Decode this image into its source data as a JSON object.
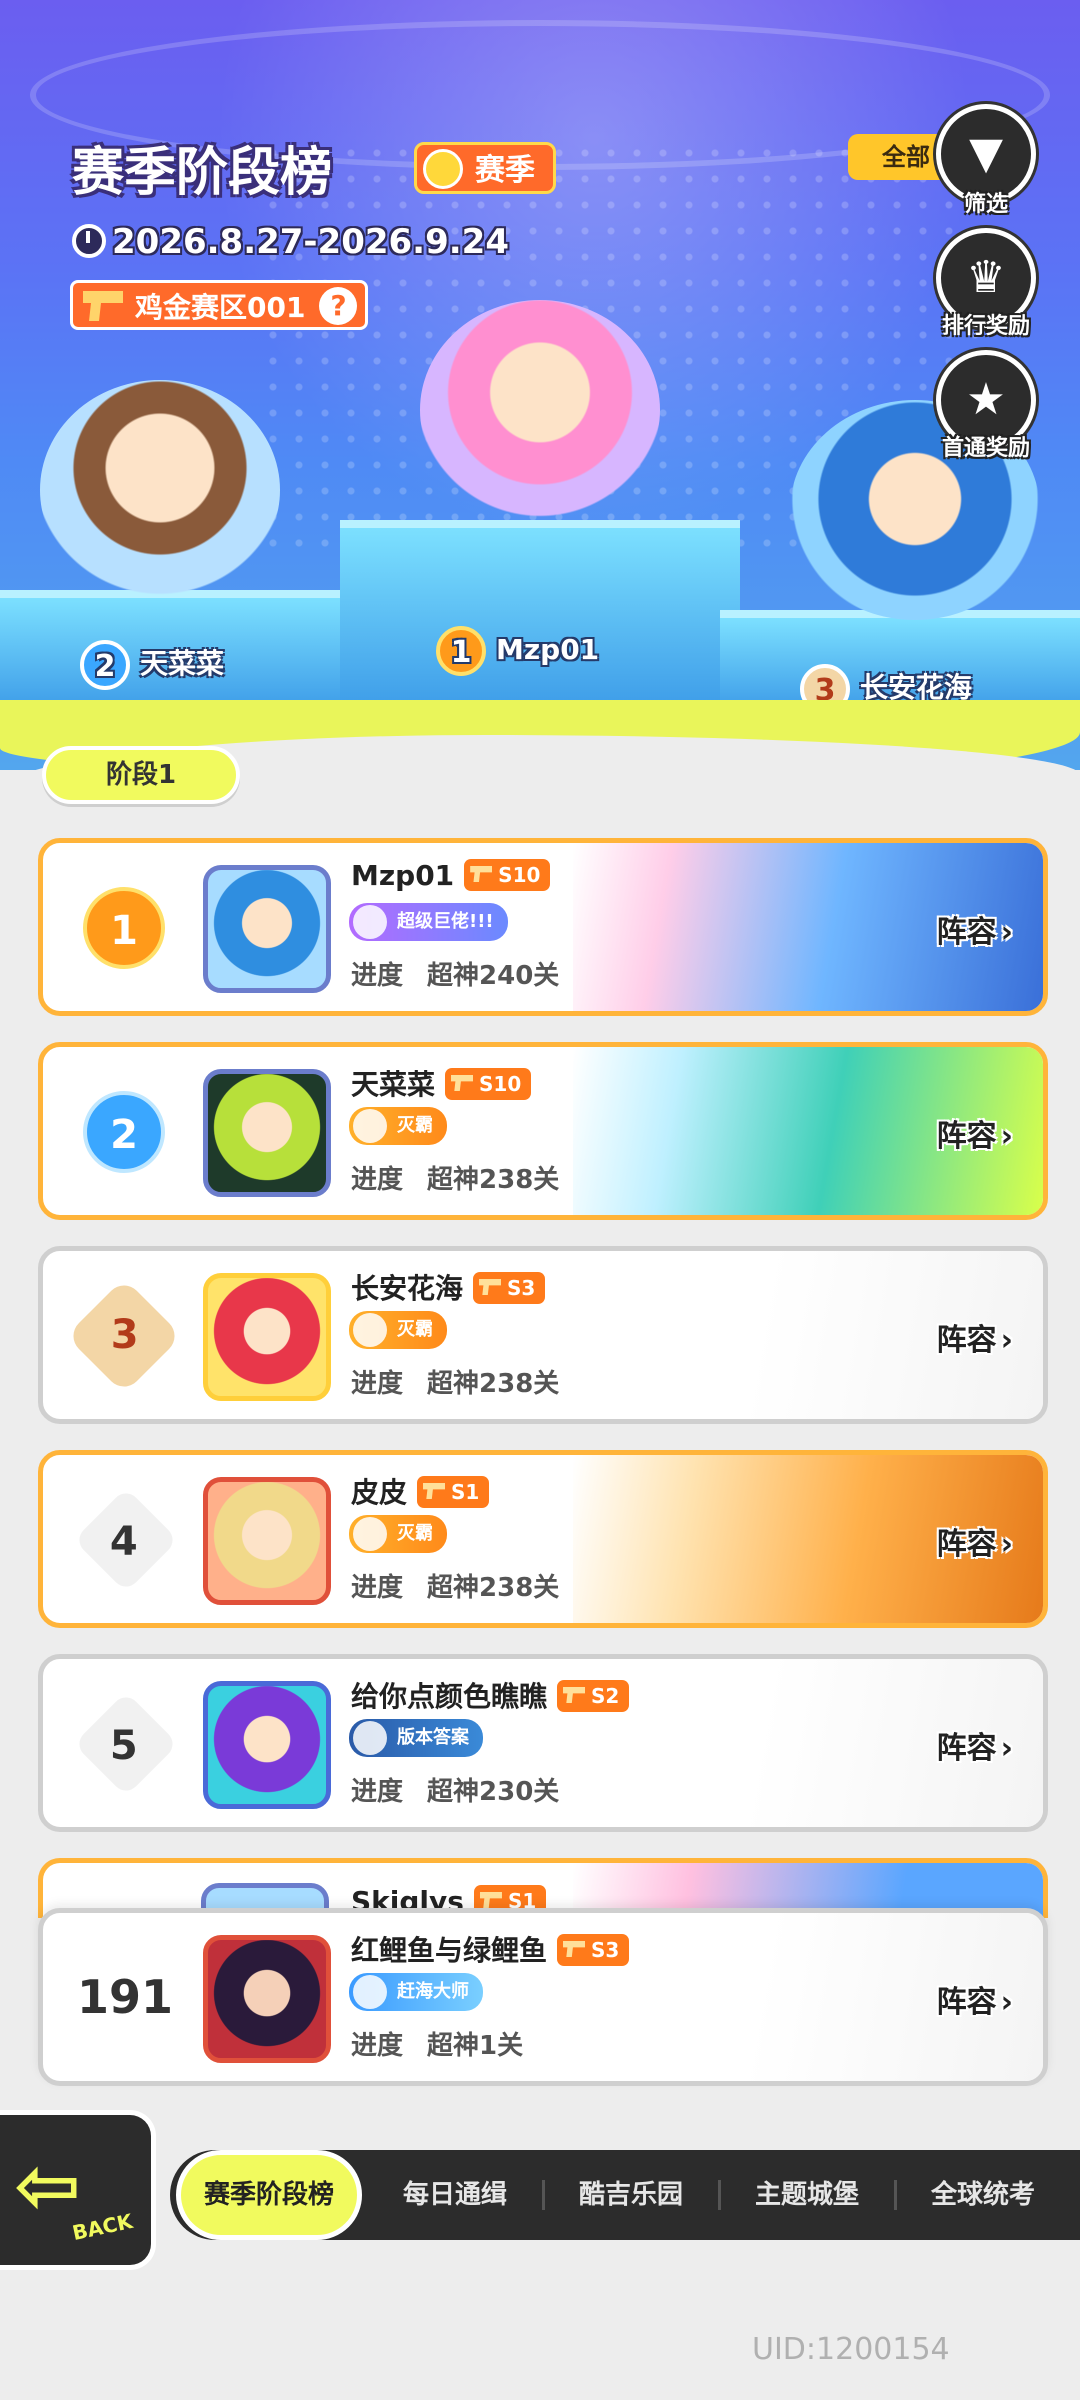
{
  "header": {
    "title": "赛季阶段榜",
    "season_badge": "赛季",
    "date_range": "2026.8.27-2026.9.24",
    "zone_label": "鸡金赛区001",
    "filter_all": "全部"
  },
  "side_buttons": [
    {
      "label": "筛选",
      "icon": "filter-icon"
    },
    {
      "label": "排行奖励",
      "icon": "ranking-reward-icon"
    },
    {
      "label": "首通奖励",
      "icon": "first-clear-reward-icon"
    }
  ],
  "podium": {
    "first": {
      "rank": "1",
      "name": "Mzp01"
    },
    "second": {
      "rank": "2",
      "name": "天菜菜"
    },
    "third": {
      "rank": "3",
      "name": "长安花海"
    }
  },
  "stage_label": "阶段1",
  "list": [
    {
      "rank": "1",
      "name": "Mzp01",
      "season": "S10",
      "title": "超级巨佬!!!",
      "progress_label": "进度",
      "progress_value": "超神240关",
      "lineup": "阵容"
    },
    {
      "rank": "2",
      "name": "天菜菜",
      "season": "S10",
      "title": "灭霸",
      "progress_label": "进度",
      "progress_value": "超神238关",
      "lineup": "阵容"
    },
    {
      "rank": "3",
      "name": "长安花海",
      "season": "S3",
      "title": "灭霸",
      "progress_label": "进度",
      "progress_value": "超神238关",
      "lineup": "阵容"
    },
    {
      "rank": "4",
      "name": "皮皮",
      "season": "S1",
      "title": "灭霸",
      "progress_label": "进度",
      "progress_value": "超神238关",
      "lineup": "阵容"
    },
    {
      "rank": "5",
      "name": "给你点颜色瞧瞧",
      "season": "S2",
      "title": "版本答案",
      "progress_label": "进度",
      "progress_value": "超神230关",
      "lineup": "阵容"
    }
  ],
  "peek_row": {
    "name": "Skiglys",
    "season": "S1"
  },
  "my_row": {
    "rank": "191",
    "name": "红鲤鱼与绿鲤鱼",
    "season": "S3",
    "title": "赶海大师",
    "progress_label": "进度",
    "progress_value": "超神1关",
    "lineup": "阵容"
  },
  "back_label": "BACK",
  "tabs": [
    "赛季阶段榜",
    "每日通缉",
    "酷吉乐园",
    "主题城堡",
    "全球统考"
  ],
  "uid": "UID:1200154",
  "colors": {
    "accent": "#f1fa5e",
    "orange": "#ff7a1a",
    "gold_border": "#ffb43a"
  }
}
